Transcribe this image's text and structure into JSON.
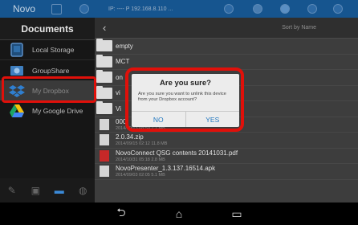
{
  "statusbar": {
    "app_title": "Novo",
    "ip_text": "IP: ---- P 192.168.8.110 ...",
    "bg_color": "#16558f"
  },
  "sidebar": {
    "title": "Documents",
    "items": [
      {
        "label": "Local Storage",
        "icon": "local-storage-icon"
      },
      {
        "label": "GroupShare",
        "icon": "groupshare-icon"
      },
      {
        "label": "My Dropbox",
        "icon": "dropbox-icon"
      },
      {
        "label": "My Google Drive",
        "icon": "google-drive-icon"
      }
    ]
  },
  "main": {
    "sort_label": "Sort by Name",
    "rows": [
      {
        "type": "folder",
        "name": "empty",
        "meta": ""
      },
      {
        "type": "folder",
        "name": "MCT",
        "meta": ""
      },
      {
        "type": "folder",
        "name": "on",
        "meta": ""
      },
      {
        "type": "folder",
        "name": "vi",
        "meta": ""
      },
      {
        "type": "folder",
        "name": "Vi",
        "meta": ""
      },
      {
        "type": "file",
        "name": "000",
        "meta": "2014/10/13 08:59   7.7 MB"
      },
      {
        "type": "file",
        "name": "2.0.34.zip",
        "meta": "2014/09/15 02:12   11.8 MB"
      },
      {
        "type": "pdf",
        "name": "NovoConnect QSG contents 20141031.pdf",
        "meta": "2014/10/31 05:18   2.8 MB"
      },
      {
        "type": "file",
        "name": "NovoPresenter_1.3.137.16514.apk",
        "meta": "2014/09/03 02:05   5.1 MB"
      }
    ]
  },
  "dialog": {
    "title": "Are you sure?",
    "message": "Are you sure you want to unlink this device from your Dropbox account?",
    "no_label": "NO",
    "yes_label": "YES",
    "highlight_color": "#e0100a"
  },
  "navbar": {
    "icons": [
      "back-icon",
      "home-icon",
      "recent-apps-icon"
    ]
  }
}
